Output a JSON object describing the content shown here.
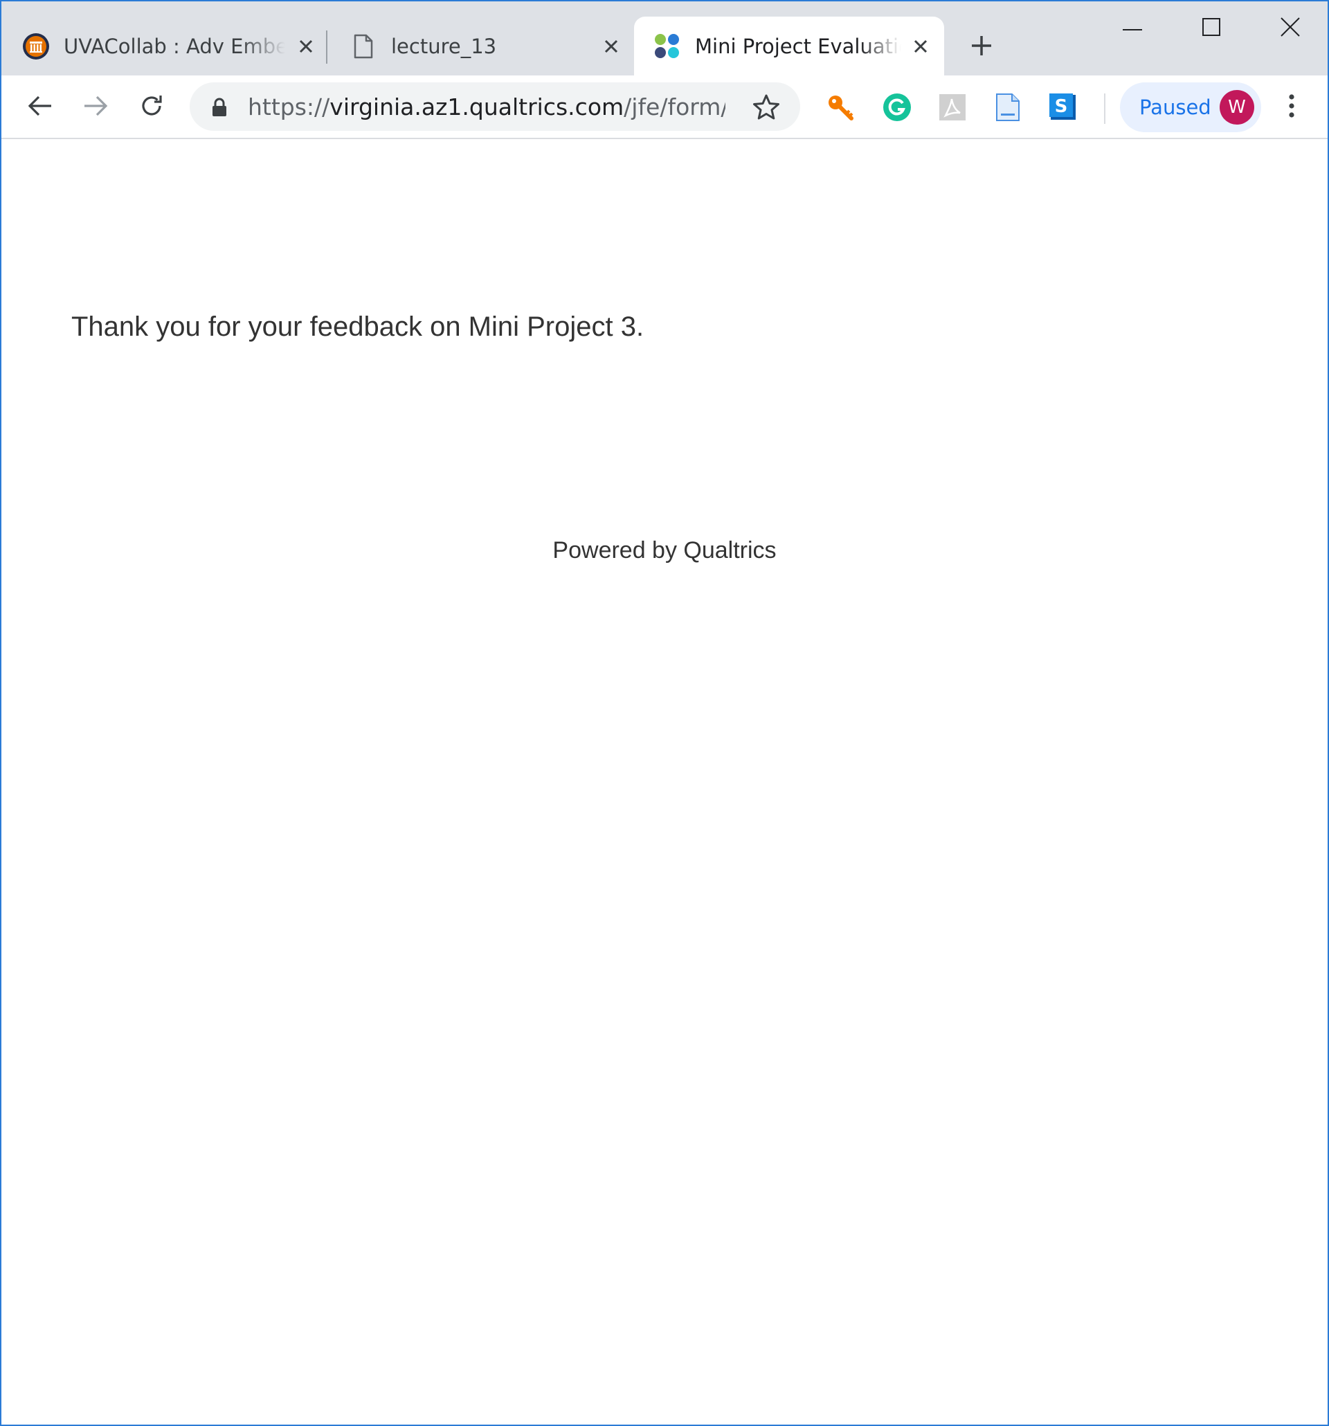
{
  "browser": {
    "tabs": [
      {
        "title": "UVACollab : Adv Embe",
        "favicon": "uva-logo-icon",
        "active": false
      },
      {
        "title": "lecture_13",
        "favicon": "document-icon",
        "active": false
      },
      {
        "title": "Mini Project Evaluatio",
        "favicon": "qualtrics-icon",
        "active": true
      }
    ],
    "address": {
      "scheme": "https://",
      "host": "virginia.az1.qualtrics.com",
      "path": "/jfe/form/S..."
    },
    "extensions": [
      "key-icon",
      "grammarly-icon",
      "pdf-icon",
      "docs-icon",
      "skype-icon"
    ],
    "profile": {
      "status": "Paused",
      "initial": "W"
    }
  },
  "page": {
    "message": "Thank you for your feedback on Mini Project 3.",
    "footer": "Powered by Qualtrics"
  },
  "colors": {
    "window_border": "#2b7bd6",
    "tabstrip_bg": "#dee1e6",
    "accent_blue": "#1a73e8",
    "avatar": "#c2185b"
  }
}
